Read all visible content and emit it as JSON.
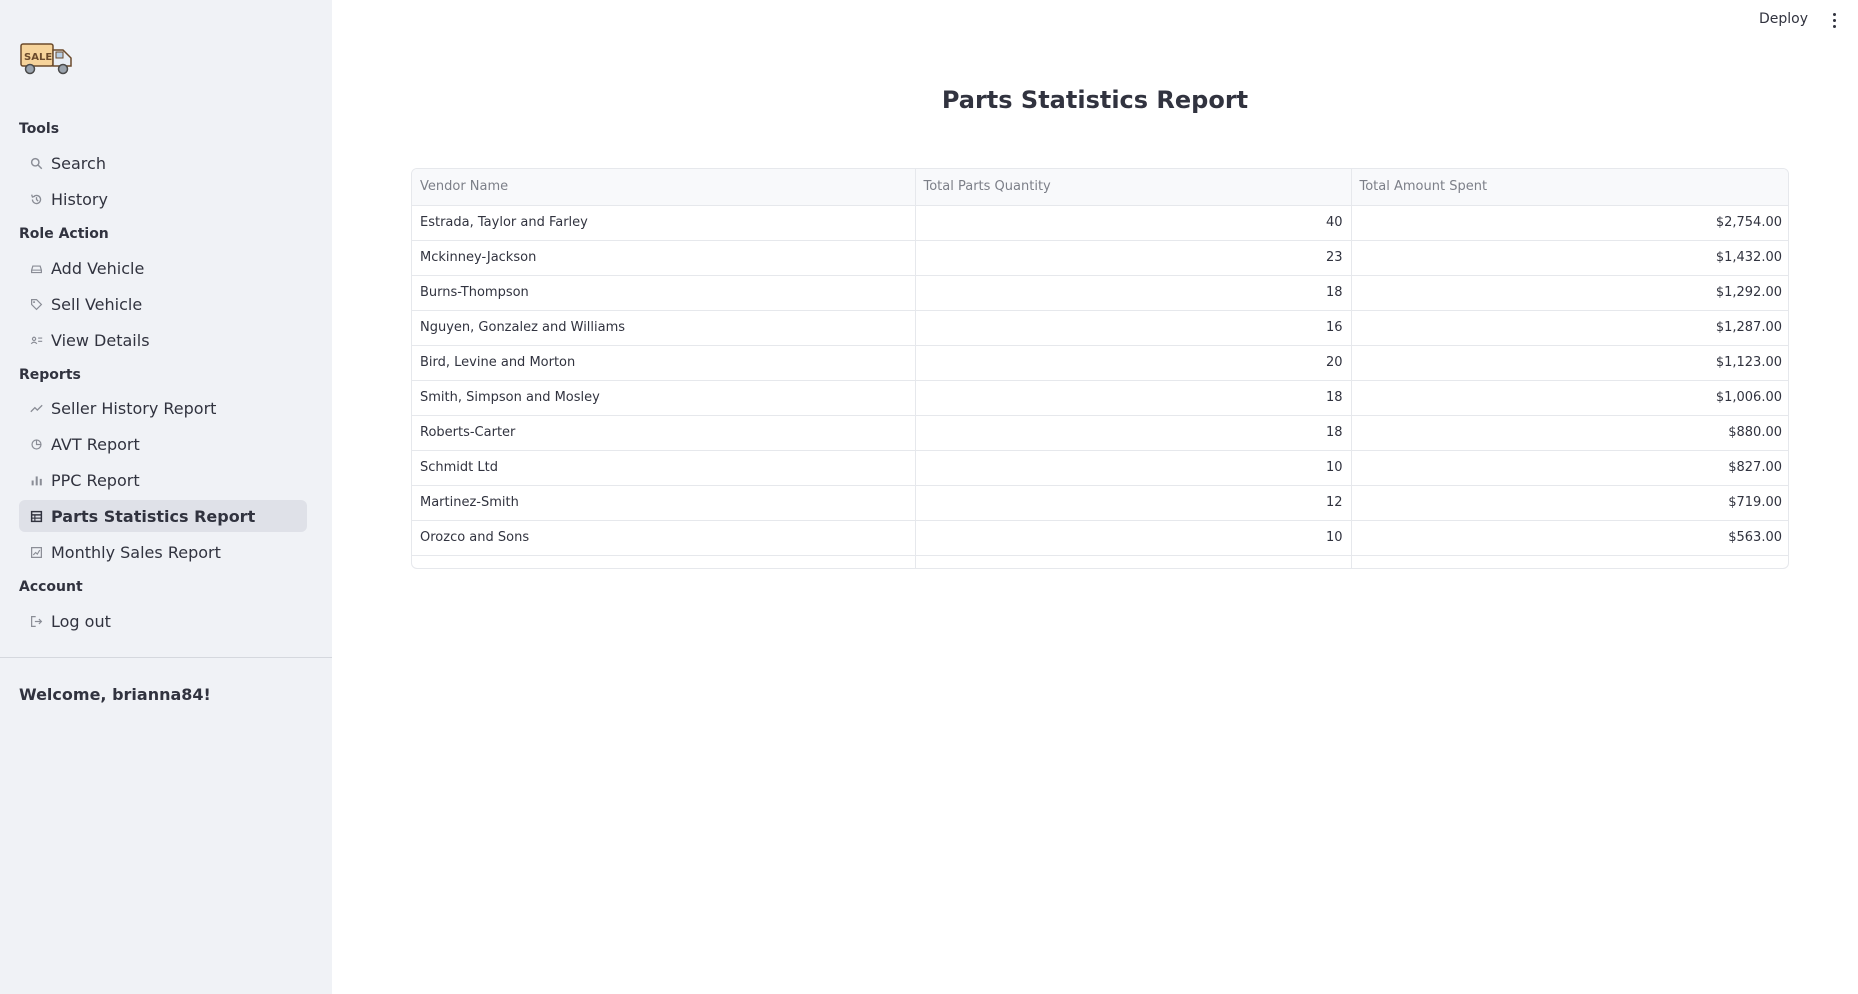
{
  "header": {
    "deploy_label": "Deploy",
    "menu_icon": "more-vertical-icon"
  },
  "sidebar": {
    "logo_icon": "sale-truck-logo",
    "sections": {
      "tools": "Tools",
      "role_action": "Role Action",
      "reports": "Reports",
      "account": "Account"
    },
    "items": [
      {
        "label": "Search",
        "icon": "search-icon"
      },
      {
        "label": "History",
        "icon": "history-icon"
      },
      {
        "label": "Add Vehicle",
        "icon": "car-icon"
      },
      {
        "label": "Sell Vehicle",
        "icon": "tag-icon"
      },
      {
        "label": "View Details",
        "icon": "list-person-icon"
      },
      {
        "label": "Seller History Report",
        "icon": "trending-icon"
      },
      {
        "label": "AVT Report",
        "icon": "database-icon"
      },
      {
        "label": "PPC Report",
        "icon": "bar-chart-icon"
      },
      {
        "label": "Parts Statistics Report",
        "icon": "table-icon"
      },
      {
        "label": "Monthly Sales Report",
        "icon": "chart-box-icon"
      },
      {
        "label": "Log out",
        "icon": "logout-icon"
      }
    ],
    "active_item": "Parts Statistics Report",
    "welcome": "Welcome, brianna84!"
  },
  "main": {
    "title": "Parts Statistics Report",
    "table": {
      "columns": [
        "Vendor Name",
        "Total Parts Quantity",
        "Total Amount Spent"
      ],
      "rows": [
        [
          "Estrada, Taylor and Farley",
          "40",
          "$2,754.00"
        ],
        [
          "Mckinney-Jackson",
          "23",
          "$1,432.00"
        ],
        [
          "Burns-Thompson",
          "18",
          "$1,292.00"
        ],
        [
          "Nguyen, Gonzalez and Williams",
          "16",
          "$1,287.00"
        ],
        [
          "Bird, Levine and Morton",
          "20",
          "$1,123.00"
        ],
        [
          "Smith, Simpson and Mosley",
          "18",
          "$1,006.00"
        ],
        [
          "Roberts-Carter",
          "18",
          "$880.00"
        ],
        [
          "Schmidt Ltd",
          "10",
          "$827.00"
        ],
        [
          "Martinez-Smith",
          "12",
          "$719.00"
        ],
        [
          "Orozco and Sons",
          "10",
          "$563.00"
        ]
      ]
    }
  }
}
